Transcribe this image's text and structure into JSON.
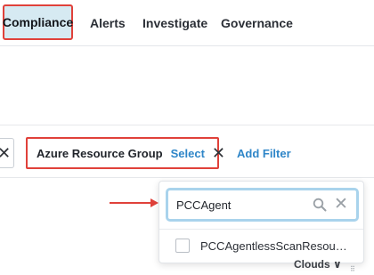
{
  "nav": {
    "tabs": [
      {
        "label": "Compliance",
        "active": true
      },
      {
        "label": "Alerts"
      },
      {
        "label": "Investigate"
      },
      {
        "label": "Governance"
      }
    ]
  },
  "filters": {
    "active_filter": {
      "label": "Azure Resource Group",
      "action_label": "Select"
    },
    "add_filter_label": "Add Filter",
    "clear_symbol": "✕"
  },
  "dropdown": {
    "search_value": "PCCAgent",
    "clear_symbol": "✕",
    "options": [
      {
        "label": "PCCAgentlessScanResourc...",
        "checked": false
      }
    ]
  },
  "background": {
    "clouds_label": "Clouds ∨"
  },
  "colors": {
    "highlight_red": "#e0413a",
    "link_blue": "#2f86c8",
    "active_tab_bg": "#d6eaf2",
    "search_focus": "#a9d3ec"
  }
}
